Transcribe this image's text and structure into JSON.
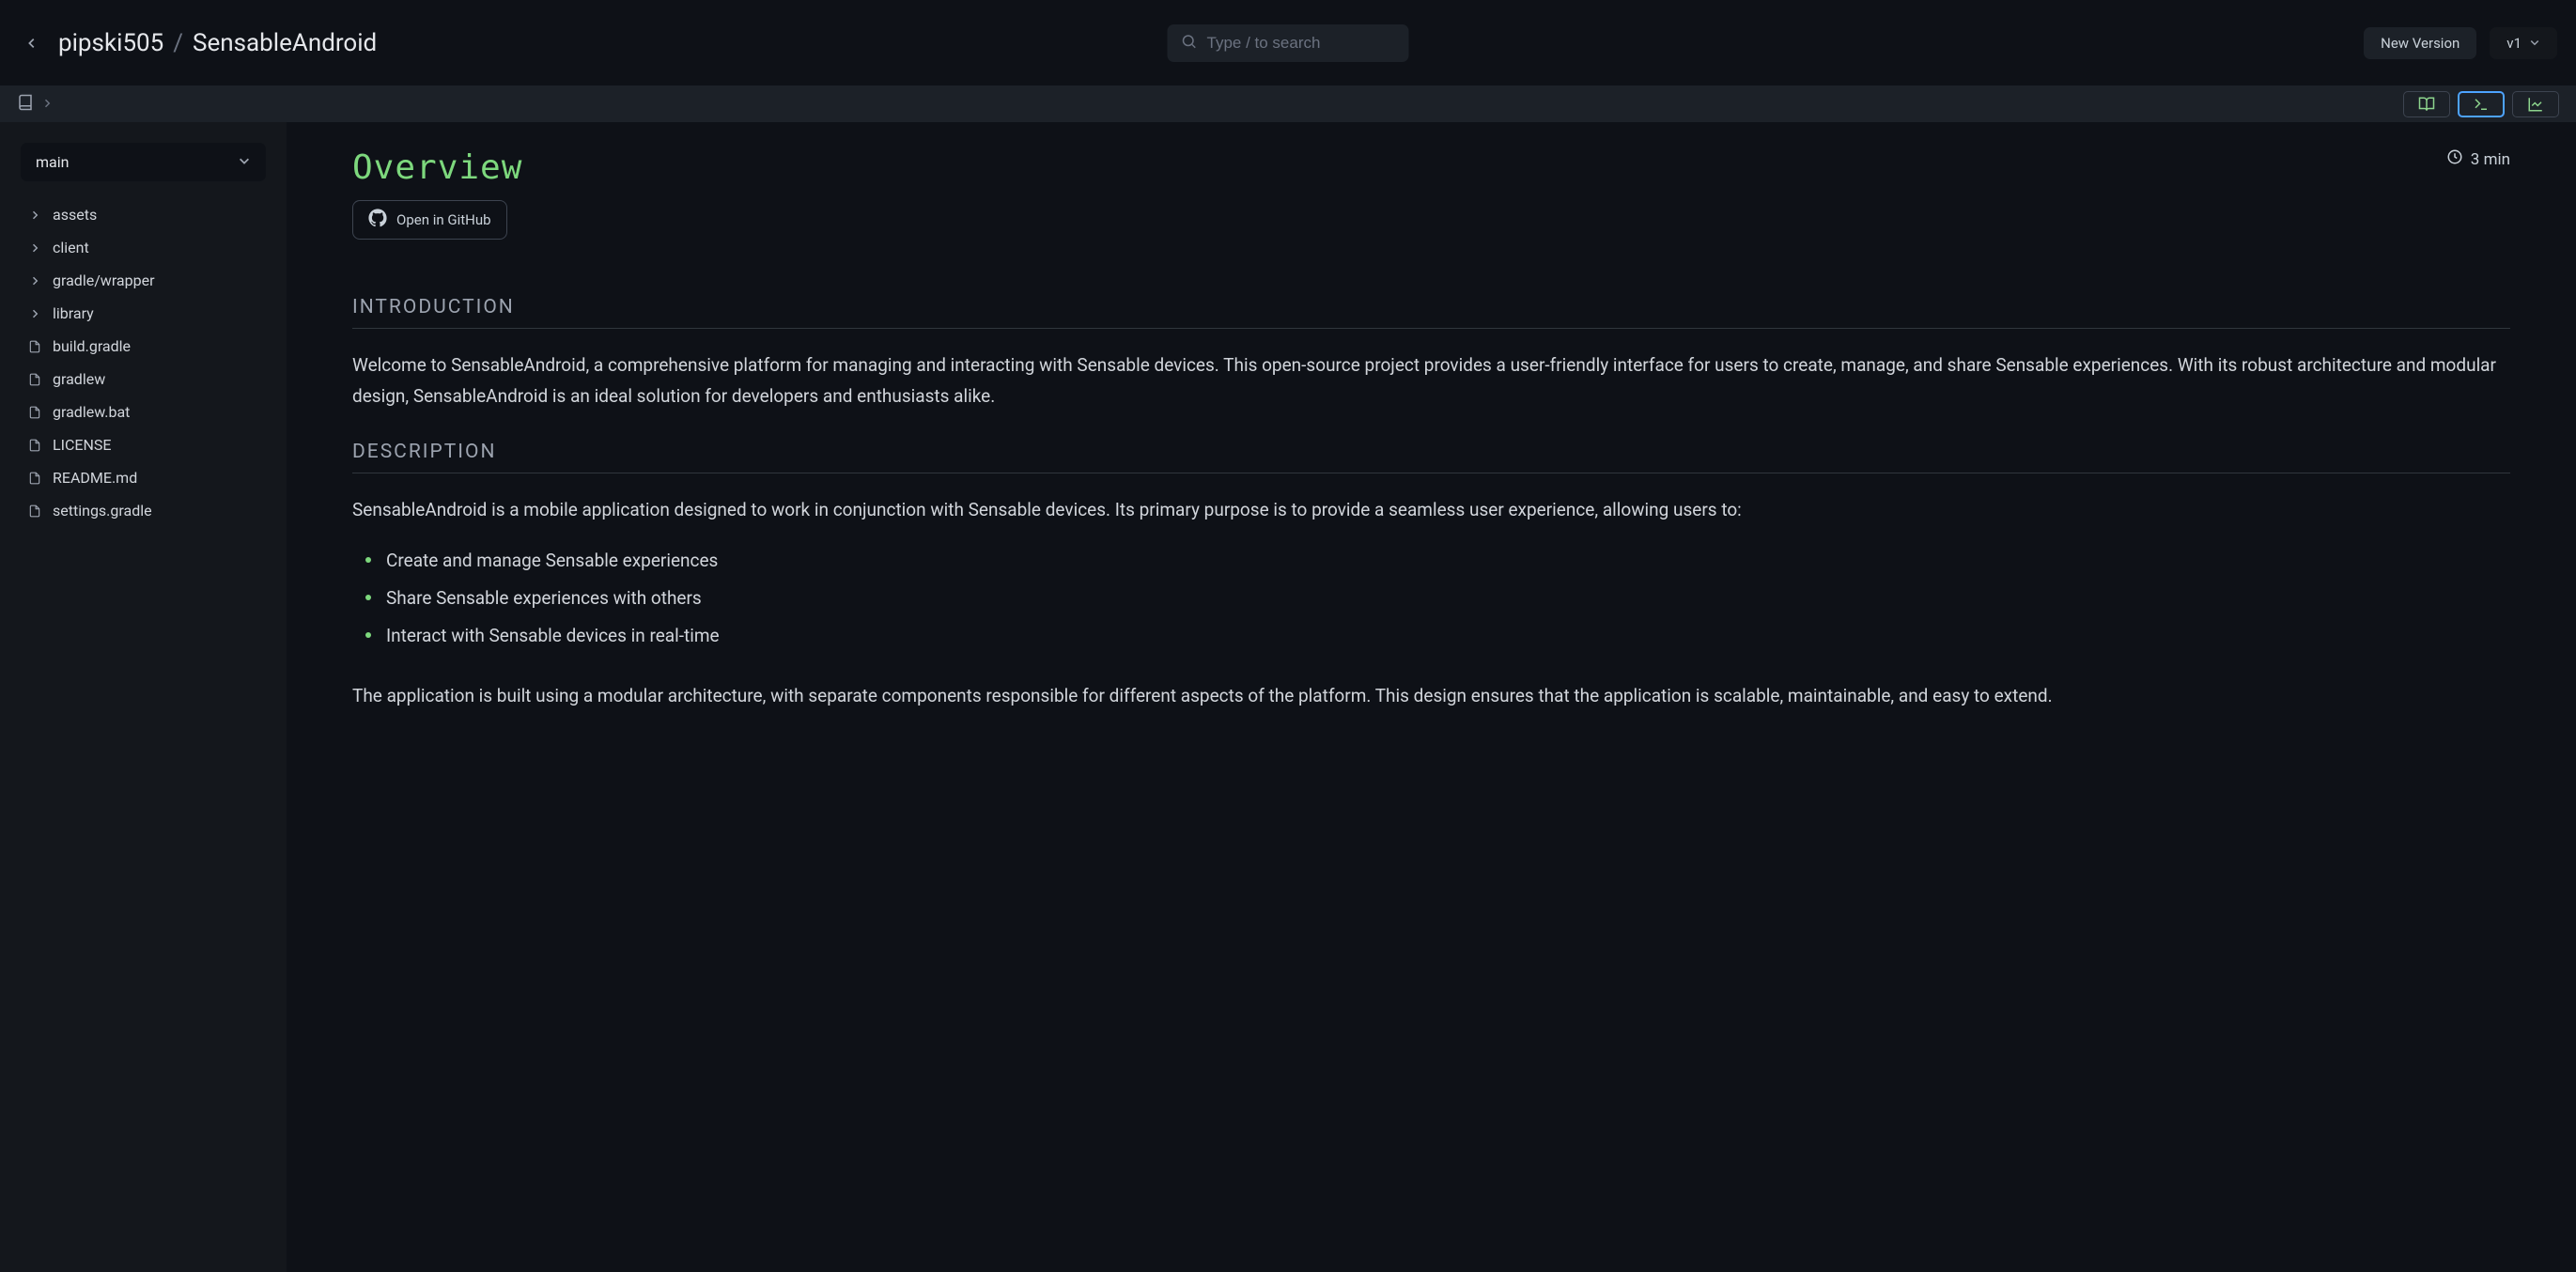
{
  "header": {
    "owner": "pipski505",
    "repo": "SensableAndroid",
    "search_placeholder": "Type / to search",
    "new_version": "New Version",
    "version": "v1"
  },
  "sidebar": {
    "branch": "main",
    "tree": [
      {
        "name": "assets",
        "type": "folder"
      },
      {
        "name": "client",
        "type": "folder"
      },
      {
        "name": "gradle/wrapper",
        "type": "folder"
      },
      {
        "name": "library",
        "type": "folder"
      },
      {
        "name": "build.gradle",
        "type": "file"
      },
      {
        "name": "gradlew",
        "type": "file"
      },
      {
        "name": "gradlew.bat",
        "type": "file"
      },
      {
        "name": "LICENSE",
        "type": "file"
      },
      {
        "name": "README.md",
        "type": "file"
      },
      {
        "name": "settings.gradle",
        "type": "file"
      }
    ]
  },
  "page": {
    "title": "Overview",
    "read_time": "3 min",
    "github_btn": "Open in GitHub",
    "sections": {
      "intro": {
        "heading": "INTRODUCTION",
        "body": "Welcome to SensableAndroid, a comprehensive platform for managing and interacting with Sensable devices. This open-source project provides a user-friendly interface for users to create, manage, and share Sensable experiences. With its robust architecture and modular design, SensableAndroid is an ideal solution for developers and enthusiasts alike."
      },
      "desc": {
        "heading": "DESCRIPTION",
        "intro": "SensableAndroid is a mobile application designed to work in conjunction with Sensable devices. Its primary purpose is to provide a seamless user experience, allowing users to:",
        "bullets": [
          "Create and manage Sensable experiences",
          "Share Sensable experiences with others",
          "Interact with Sensable devices in real-time"
        ],
        "body2": "The application is built using a modular architecture, with separate components responsible for different aspects of the platform. This design ensures that the application is scalable, maintainable, and easy to extend."
      }
    }
  }
}
